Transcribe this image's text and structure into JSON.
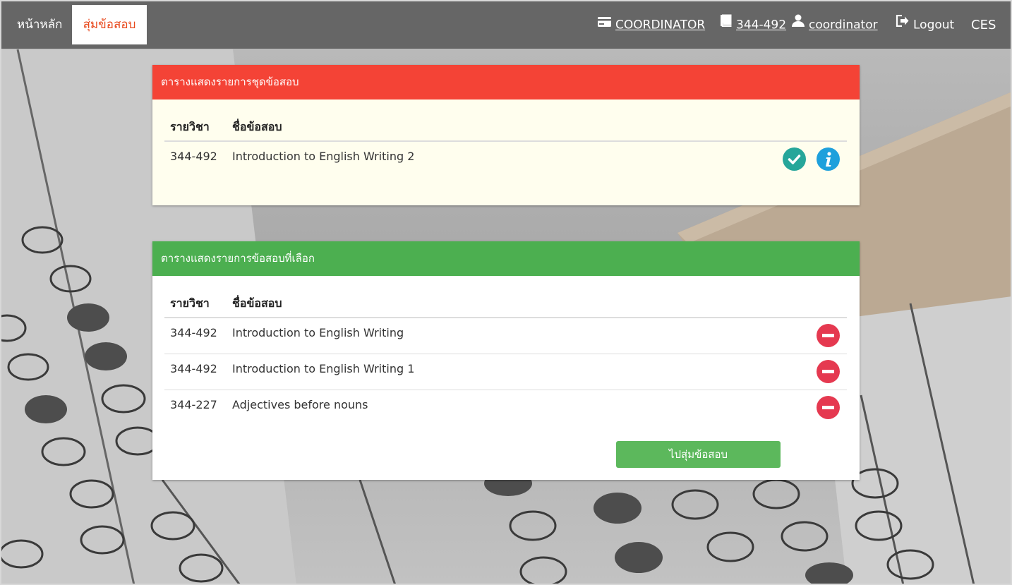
{
  "nav": {
    "home_label": "หน้าหลัก",
    "random_label": "สุ่มข้อสอบ",
    "role_label": "COORDINATOR",
    "course_label": "344-492",
    "user_label": "coordinator",
    "logout_label": "Logout",
    "brand_label": "CES",
    "icons": [
      "id-card-icon",
      "book-icon",
      "user-icon",
      "logout-icon"
    ]
  },
  "exam_sets_panel": {
    "title": "ตารางแสดงรายการชุดข้อสอบ",
    "header_color": "#f44336",
    "columns": [
      "รายวิชา",
      "ชื่อข้อสอบ"
    ],
    "rows": [
      {
        "code": "344-492",
        "name": "Introduction to English Writing 2",
        "actions": [
          "check-icon",
          "info-icon"
        ]
      }
    ]
  },
  "selected_panel": {
    "title": "ตารางแสดงรายการข้อสอบที่เลือก",
    "header_color": "#4caf50",
    "columns": [
      "รายวิชา",
      "ชื่อข้อสอบ"
    ],
    "rows": [
      {
        "code": "344-492",
        "name": "Introduction to English Writing",
        "actions": [
          "remove-icon"
        ]
      },
      {
        "code": "344-492",
        "name": "Introduction to English Writing 1",
        "actions": [
          "remove-icon"
        ]
      },
      {
        "code": "344-227",
        "name": "Adjectives before nouns",
        "actions": [
          "remove-icon"
        ]
      }
    ],
    "submit_label": "ไปสุ่มข้อสอบ"
  },
  "colors": {
    "nav_bg": "#666666",
    "active_tab_text": "#e8491d",
    "check": "#26a69a",
    "info": "#1ea0dc",
    "remove": "#e53950",
    "submit": "#5cb85c"
  }
}
